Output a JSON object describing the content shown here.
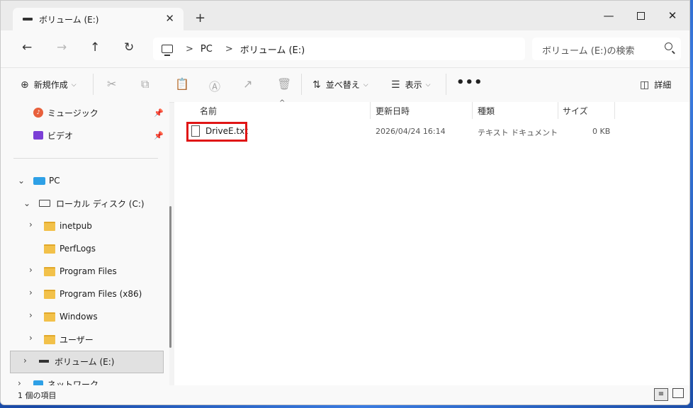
{
  "window": {
    "tab_title": "ボリューム (E:)",
    "new_tab_symbol": "+",
    "tab_close_symbol": "✕",
    "minimize_symbol": "—",
    "close_symbol": "✕"
  },
  "addressbar": {
    "back_symbol": "←",
    "forward_symbol": "→",
    "up_symbol": "↑",
    "refresh_symbol": "↻",
    "crumbs": [
      "PC",
      "ボリューム (E:)"
    ],
    "separator": ">",
    "search_placeholder": "ボリューム (E:)の検索"
  },
  "commandbar": {
    "new_label": "新規作成",
    "sort_label": "並べ替え",
    "view_label": "表示",
    "more_label": "•••",
    "details_label": "詳細",
    "icons": [
      "cut-icon",
      "copy-icon",
      "paste-icon",
      "rename-icon",
      "share-icon",
      "delete-icon"
    ]
  },
  "sidebar": {
    "quick": [
      {
        "label": "ミュージック",
        "icon": "music-icon"
      },
      {
        "label": "ビデオ",
        "icon": "video-icon"
      }
    ],
    "pc_label": "PC",
    "local_disk_label": "ローカル ディスク (C:)",
    "folders": [
      "inetpub",
      "PerfLogs",
      "Program Files",
      "Program Files (x86)",
      "Windows",
      "ユーザー"
    ],
    "volume_label": "ボリューム (E:)",
    "network_label": "ネットワーク"
  },
  "columns": {
    "name": "名前",
    "date": "更新日時",
    "type": "種類",
    "size": "サイズ"
  },
  "files": [
    {
      "name": "DriveE.txt",
      "date": "2026/04/24 16:14",
      "type": "テキスト ドキュメント",
      "size": "0 KB"
    }
  ],
  "status": {
    "item_count": "1 個の項目"
  },
  "colors": {
    "highlight_box": "#e01515",
    "accent": "#2ea0e6"
  }
}
